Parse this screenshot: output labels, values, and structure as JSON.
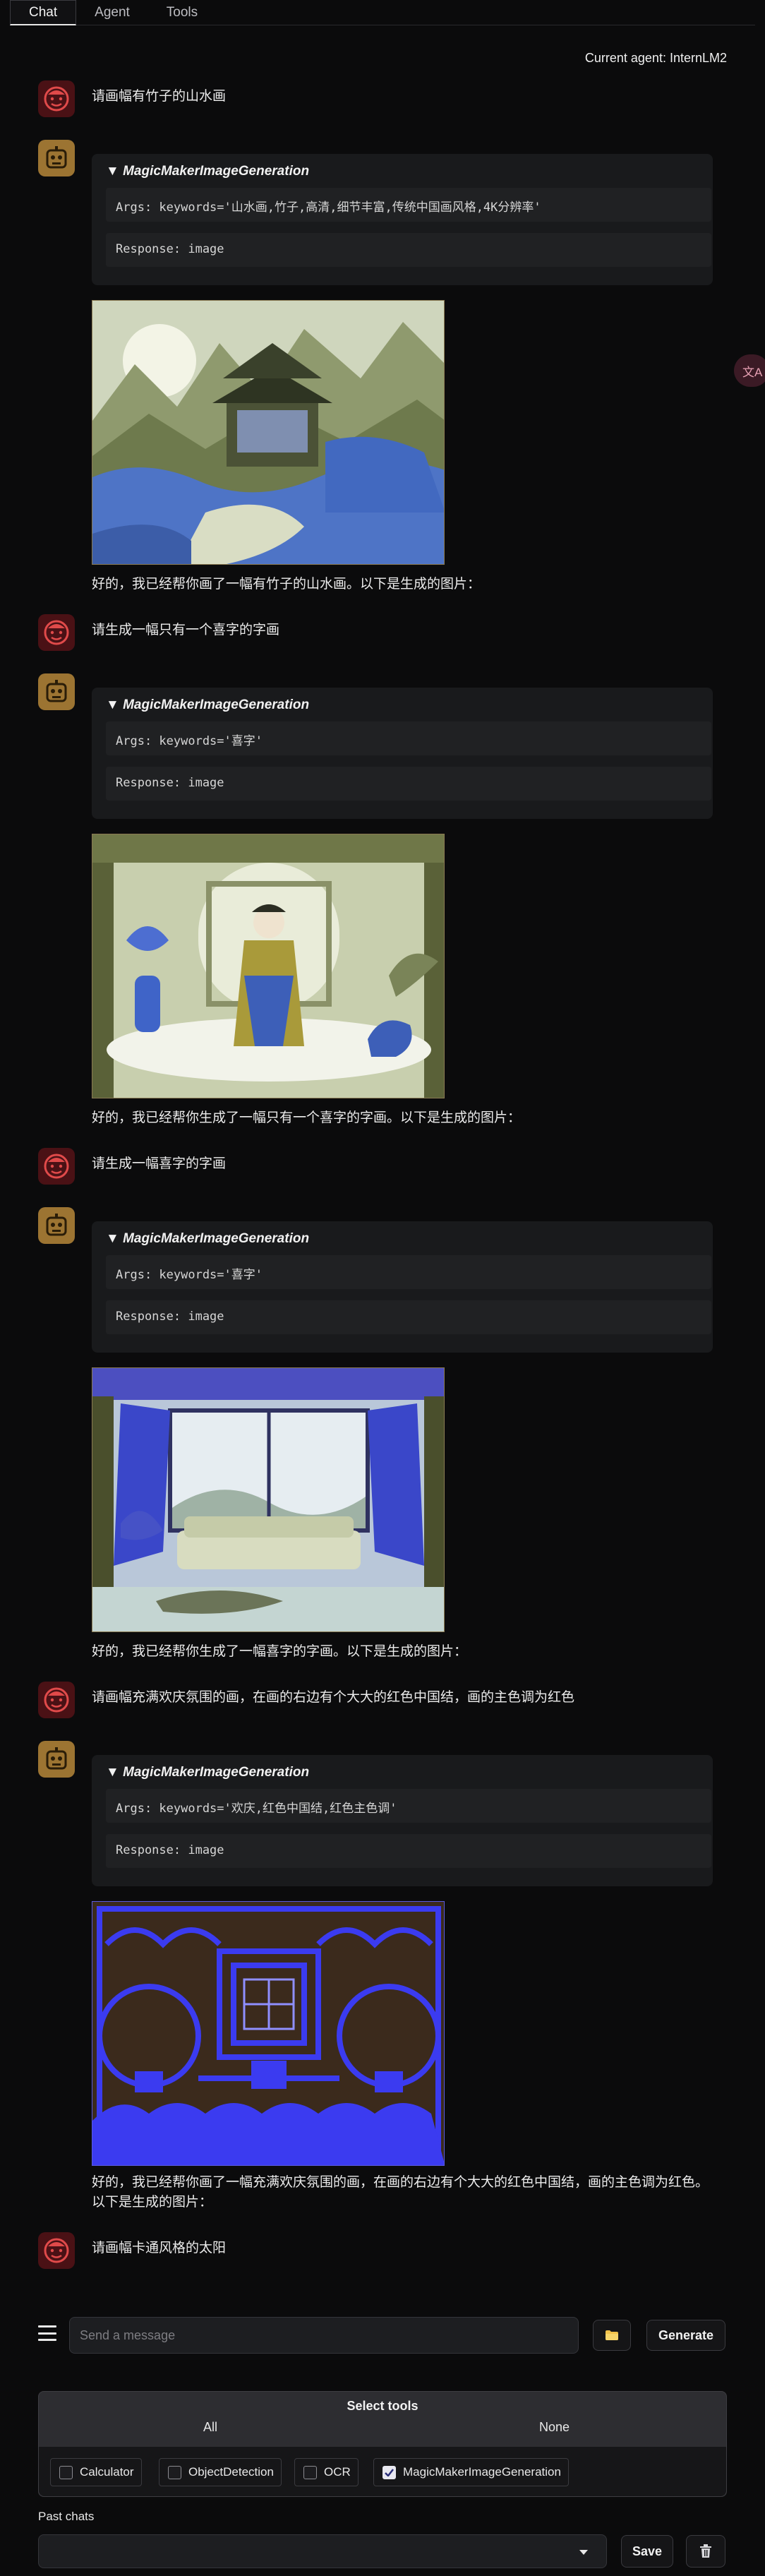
{
  "tabs": [
    {
      "label": "Chat",
      "active": true
    },
    {
      "label": "Agent",
      "active": false
    },
    {
      "label": "Tools",
      "active": false
    }
  ],
  "current_agent_text": "Current agent: InternLM2",
  "translate_icon_glyph": "文A",
  "conversation": [
    {
      "user": "请画幅有竹子的山水画",
      "tool_name": "MagicMakerImageGeneration",
      "args": "Args: keywords='山水画,竹子,高清,细节丰富,传统中国画风格,4K分辨率'",
      "response": "Response: image",
      "reply": "好的，我已经帮你画了一幅有竹子的山水画。以下是生成的图片："
    },
    {
      "user": "请生成一幅只有一个喜字的字画",
      "tool_name": "MagicMakerImageGeneration",
      "args": "Args: keywords='喜字'",
      "response": "Response: image",
      "reply": "好的，我已经帮你生成了一幅只有一个喜字的字画。以下是生成的图片："
    },
    {
      "user": "请生成一幅喜字的字画",
      "tool_name": "MagicMakerImageGeneration",
      "args": "Args: keywords='喜字'",
      "response": "Response: image",
      "reply": "好的，我已经帮你生成了一幅喜字的字画。以下是生成的图片："
    },
    {
      "user": "请画幅充满欢庆氛围的画，在画的右边有个大大的红色中国结，画的主色调为红色",
      "tool_name": "MagicMakerImageGeneration",
      "args": "Args: keywords='欢庆,红色中国结,红色主色调'",
      "response": "Response: image",
      "reply_lines": [
        "好的，我已经帮你画了一幅充满欢庆氛围的画，在画的右边有个大大的红色中国结，画的主色调为红色。",
        "以下是生成的图片："
      ]
    },
    {
      "user": "请画幅卡通风格的太阳"
    }
  ],
  "input": {
    "placeholder": "Send a message",
    "value": ""
  },
  "buttons": {
    "generate": "Generate",
    "save": "Save"
  },
  "tools_panel": {
    "title": "Select tools",
    "all_label": "All",
    "none_label": "None",
    "tools": [
      {
        "label": "Calculator",
        "checked": false
      },
      {
        "label": "ObjectDetection",
        "checked": false
      },
      {
        "label": "OCR",
        "checked": false
      },
      {
        "label": "MagicMakerImageGeneration",
        "checked": true
      }
    ]
  },
  "past_chats": {
    "label": "Past chats",
    "selected": ""
  },
  "icons": {
    "user_avatar": "user-face-icon",
    "bot_avatar": "robot-icon",
    "menu": "hamburger-menu-icon",
    "folder": "folder-icon",
    "trash": "trash-icon"
  }
}
